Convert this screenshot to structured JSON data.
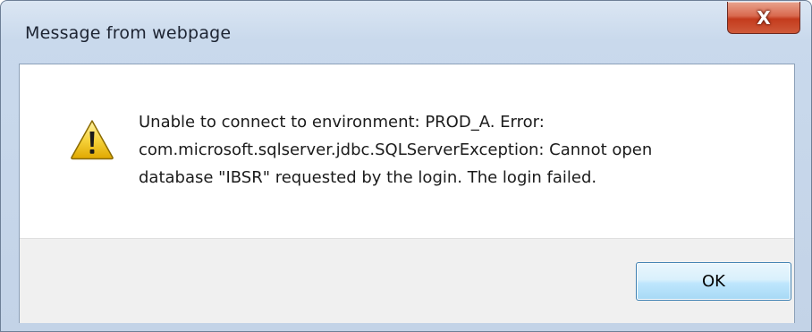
{
  "dialog": {
    "title": "Message from webpage",
    "close_label": "X",
    "message_lines": [
      "Unable to connect to environment: PROD_A.  Error:",
      "com.microsoft.sqlserver.jdbc.SQLServerException: Cannot open",
      "database \"IBSR\" requested by the login. The login failed."
    ],
    "icon": "warning-icon",
    "ok_label": "OK"
  },
  "colors": {
    "frame": "#c9d9ec",
    "close_button": "#c43b1d",
    "ok_button_border": "#3c7fb1",
    "warning_fill": "#f4c20d"
  }
}
